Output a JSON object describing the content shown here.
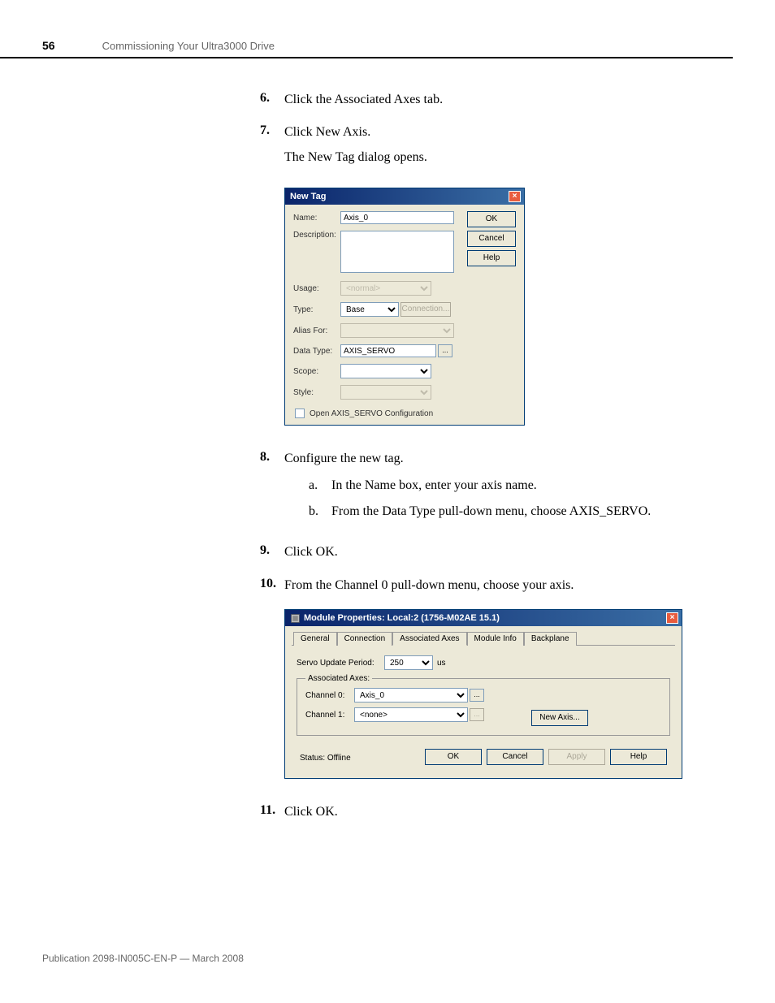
{
  "page": {
    "number": "56",
    "headerTitle": "Commissioning Your Ultra3000 Drive",
    "footer": "Publication 2098-IN005C-EN-P — March 2008"
  },
  "steps": {
    "s6": {
      "num": "6.",
      "text": "Click the Associated Axes tab."
    },
    "s7": {
      "num": "7.",
      "text": "Click New Axis.",
      "sub": "The New Tag dialog opens."
    },
    "s8": {
      "num": "8.",
      "text": "Configure the new tag.",
      "a": {
        "letter": "a.",
        "text": "In the Name box, enter your axis name."
      },
      "b": {
        "letter": "b.",
        "text": "From the Data Type pull-down menu, choose AXIS_SERVO."
      }
    },
    "s9": {
      "num": "9.",
      "text": "Click OK."
    },
    "s10": {
      "num": "10.",
      "text": "From the Channel 0 pull-down menu, choose your axis."
    },
    "s11": {
      "num": "11.",
      "text": "Click OK."
    }
  },
  "newTag": {
    "title": "New Tag",
    "labels": {
      "name": "Name:",
      "description": "Description:",
      "usage": "Usage:",
      "type": "Type:",
      "aliasFor": "Alias For:",
      "dataType": "Data Type:",
      "scope": "Scope:",
      "style": "Style:"
    },
    "values": {
      "name": "Axis_0",
      "usage": "<normal>",
      "type": "Base",
      "dataType": "AXIS_SERVO"
    },
    "buttons": {
      "ok": "OK",
      "cancel": "Cancel",
      "help": "Help",
      "connection": "Connection...",
      "browse": "..."
    },
    "checkbox": "Open AXIS_SERVO Configuration"
  },
  "moduleProps": {
    "title": "Module Properties: Local:2 (1756-M02AE 15.1)",
    "tabs": {
      "general": "General",
      "connection": "Connection",
      "associatedAxes": "Associated Axes",
      "moduleInfo": "Module Info",
      "backplane": "Backplane"
    },
    "servoUpdateLabel": "Servo Update Period:",
    "servoUpdateValue": "250",
    "servoUpdateUnit": "us",
    "fieldsetLegend": "Associated Axes:",
    "channel0Label": "Channel 0:",
    "channel0Value": "Axis_0",
    "channel1Label": "Channel 1:",
    "channel1Value": "<none>",
    "newAxisBtn": "New Axis...",
    "browse": "...",
    "status": "Status: Offline",
    "buttons": {
      "ok": "OK",
      "cancel": "Cancel",
      "apply": "Apply",
      "help": "Help"
    }
  }
}
